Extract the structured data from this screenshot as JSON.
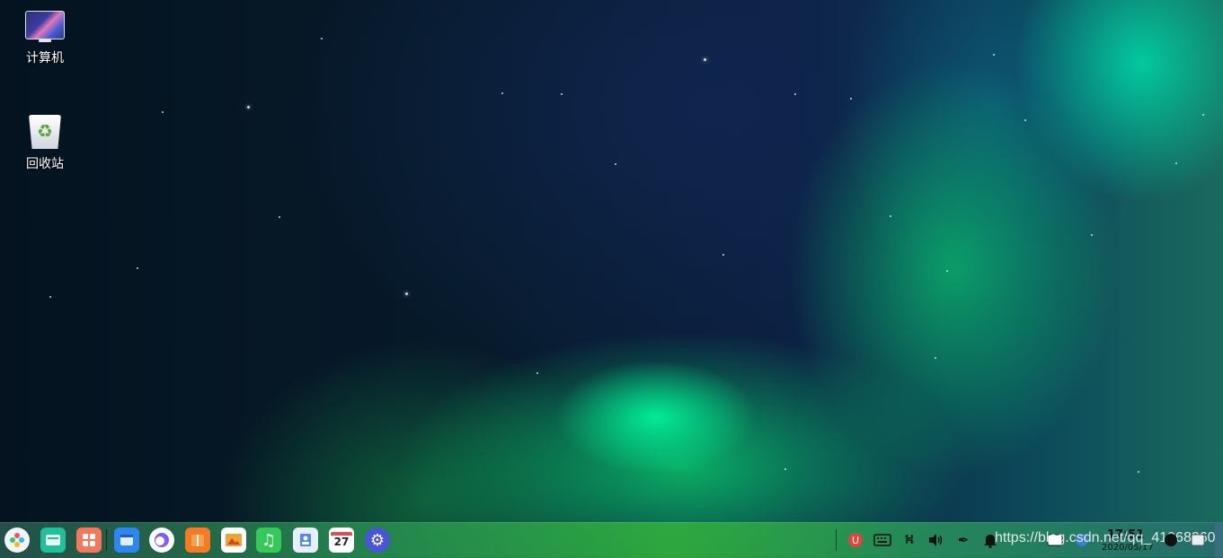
{
  "desktop": {
    "icons": [
      {
        "label": "计算机",
        "icon": "computer-icon"
      },
      {
        "label": "回收站",
        "icon": "recycle-bin-icon"
      }
    ]
  },
  "taskbar": {
    "apps": [
      {
        "icon": "launcher-icon",
        "color": "#ffffff"
      },
      {
        "icon": "file-manager-icon",
        "color": "#21c29a"
      },
      {
        "icon": "app-store-icon",
        "color": "#f6775b"
      },
      {
        "icon": "browser-icon",
        "color": "#2f86f0"
      },
      {
        "icon": "music-player-icon",
        "color": "#7c5cff"
      },
      {
        "icon": "archive-icon",
        "color": "#f57a24"
      },
      {
        "icon": "image-viewer-icon",
        "color": "#f2a233"
      },
      {
        "icon": "music-icon",
        "color": "#35c95a"
      },
      {
        "icon": "contacts-icon",
        "color": "#4f8ae8"
      },
      {
        "icon": "calendar-icon",
        "color": "#ffffff"
      },
      {
        "icon": "settings-icon",
        "color": "#4a54d8"
      }
    ],
    "calendar_day": "27",
    "tray": [
      {
        "icon": "antivirus-icon"
      },
      {
        "icon": "keyboard-icon"
      },
      {
        "icon": "usb-icon"
      },
      {
        "icon": "volume-icon"
      },
      {
        "icon": "pen-icon"
      },
      {
        "icon": "notification-bell-icon"
      },
      {
        "icon": "input-method-icon"
      },
      {
        "icon": "network-icon"
      }
    ],
    "clock": {
      "time": "17:51",
      "date": "2020/05/17"
    },
    "watermark": "https://blog.csdn.net/qq_41968260"
  }
}
